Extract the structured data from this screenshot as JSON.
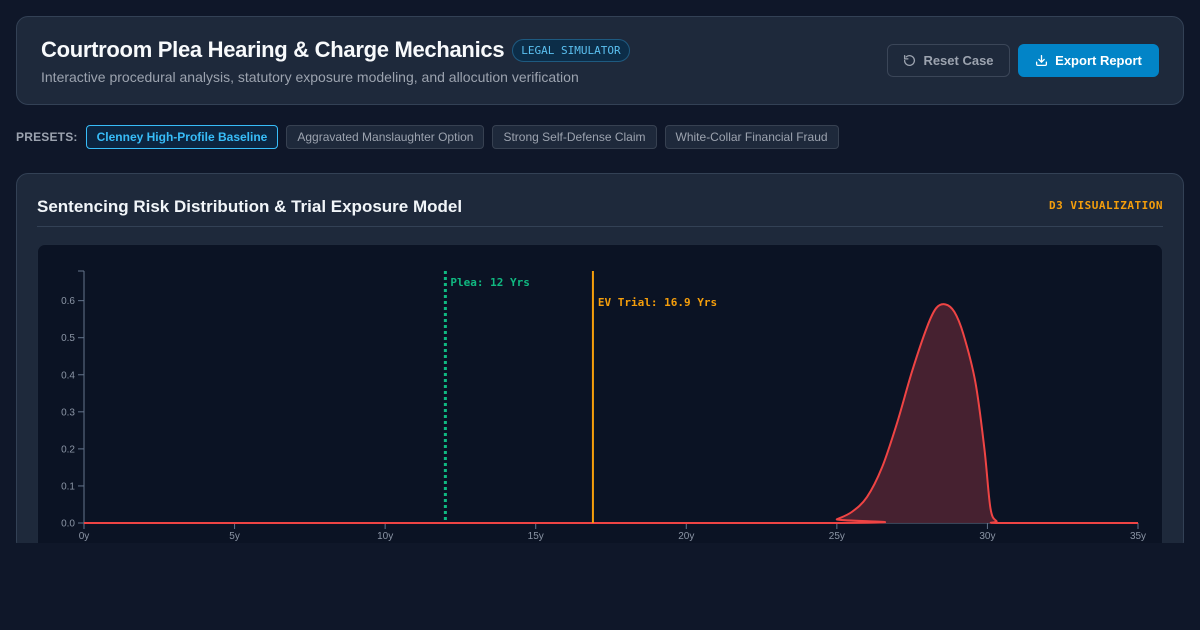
{
  "header": {
    "title": "Courtroom Plea Hearing & Charge Mechanics",
    "badge": "LEGAL SIMULATOR",
    "subtitle": "Interactive procedural analysis, statutory exposure modeling, and allocution verification",
    "reset_label": "Reset Case",
    "export_label": "Export Report",
    "reset_icon": "rotate-ccw-icon",
    "export_icon": "download-icon"
  },
  "presets": {
    "label": "PRESETS:",
    "items": [
      {
        "label": "Clenney High-Profile Baseline",
        "active": true
      },
      {
        "label": "Aggravated Manslaughter Option",
        "active": false
      },
      {
        "label": "Strong Self-Defense Claim",
        "active": false
      },
      {
        "label": "White-Collar Financial Fraud",
        "active": false
      }
    ]
  },
  "panel": {
    "title": "Sentencing Risk Distribution & Trial Exposure Model",
    "tag": "D3 VISUALIZATION"
  },
  "colors": {
    "accent": "#0284c7",
    "plea_line": "#10b981",
    "ev_line": "#f59e0b",
    "density": "#ef4444",
    "density_fill": "#4a2232"
  },
  "chart_data": {
    "type": "area",
    "xlim": [
      0,
      35
    ],
    "ylim": [
      0,
      0.68
    ],
    "x_ticks": [
      0,
      5,
      10,
      15,
      20,
      25,
      30,
      35
    ],
    "x_tick_labels": [
      "0y",
      "5y",
      "10y",
      "15y",
      "20y",
      "25y",
      "30y",
      "35y"
    ],
    "y_ticks": [
      0,
      0.1,
      0.2,
      0.3,
      0.4,
      0.5,
      0.6
    ],
    "y_tick_labels": [
      "0.0",
      "0.1",
      "0.2",
      "0.3",
      "0.4",
      "0.5",
      "0.6"
    ],
    "series": [
      {
        "x": [
          0,
          24.7,
          25,
          25.5,
          26,
          26.5,
          27,
          27.5,
          28,
          28.3,
          28.6,
          28.9,
          29.2,
          29.6,
          29.9,
          30.1,
          30.3,
          30.5,
          35
        ],
        "values": [
          0,
          0,
          0.01,
          0.03,
          0.07,
          0.15,
          0.27,
          0.41,
          0.53,
          0.58,
          0.59,
          0.57,
          0.51,
          0.38,
          0.2,
          0.04,
          0.005,
          0,
          0
        ]
      }
    ],
    "markers": [
      {
        "label": "Plea: 12 Yrs",
        "x": 12,
        "style": "dashed"
      },
      {
        "label": "EV Trial: 16.9 Yrs",
        "x": 16.9,
        "style": "solid"
      }
    ],
    "grid": false
  }
}
